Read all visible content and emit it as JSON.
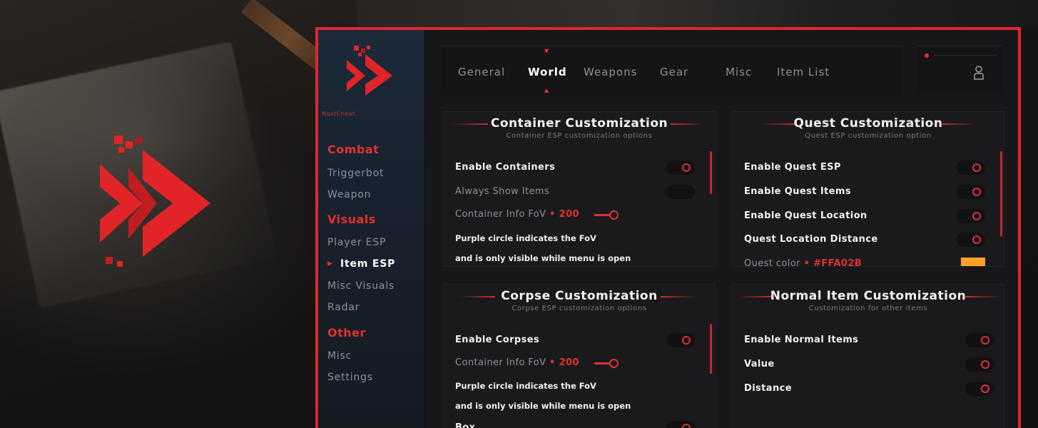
{
  "brand": "NextCheat",
  "colors": {
    "accent": "#e2262b",
    "quest_color": "#FFA02B"
  },
  "sidebar": {
    "sections": [
      {
        "label": "Combat",
        "items": [
          "Triggerbot",
          "Weapon"
        ]
      },
      {
        "label": "Visuals",
        "items": [
          "Player ESP",
          "Item ESP",
          "Misc Visuals",
          "Radar"
        ]
      },
      {
        "label": "Other",
        "items": [
          "Misc",
          "Settings"
        ]
      }
    ],
    "active_item": "Item ESP"
  },
  "tabs": [
    "General",
    "World",
    "Weapons",
    "Gear",
    "Misc",
    "Item List"
  ],
  "active_tab": "World",
  "user_icon": "user-icon",
  "panels": {
    "container": {
      "title": "Container Customization",
      "subtitle": "Container ESP customization options",
      "enable_label": "Enable Containers",
      "always_show_label": "Always Show Items",
      "fov_label": "Container Info FoV",
      "fov_value": "200",
      "note1": "Purple circle indicates the FoV",
      "note2": "and is only visible while menu is open"
    },
    "quest": {
      "title": "Quest Customization",
      "subtitle": "Quest ESP customization option",
      "rows": [
        "Enable Quest ESP",
        "Enable Quest Items",
        "Enable Quest Location",
        "Quest Location Distance"
      ],
      "color_label": "Quest color",
      "color_value": "#FFA02B"
    },
    "corpse": {
      "title": "Corpse Customization",
      "subtitle": "Corpse ESP customization options",
      "enable_label": "Enable Corpses",
      "fov_label": "Container Info FoV",
      "fov_value": "200",
      "note1": "Purple circle indicates the FoV",
      "note2": "and is only visible while menu is open",
      "box_label": "Box"
    },
    "normal": {
      "title": "Normal Item Customization",
      "subtitle": "Customization for other items",
      "rows": [
        "Enable Normal Items",
        "Value",
        "Distance"
      ]
    }
  }
}
